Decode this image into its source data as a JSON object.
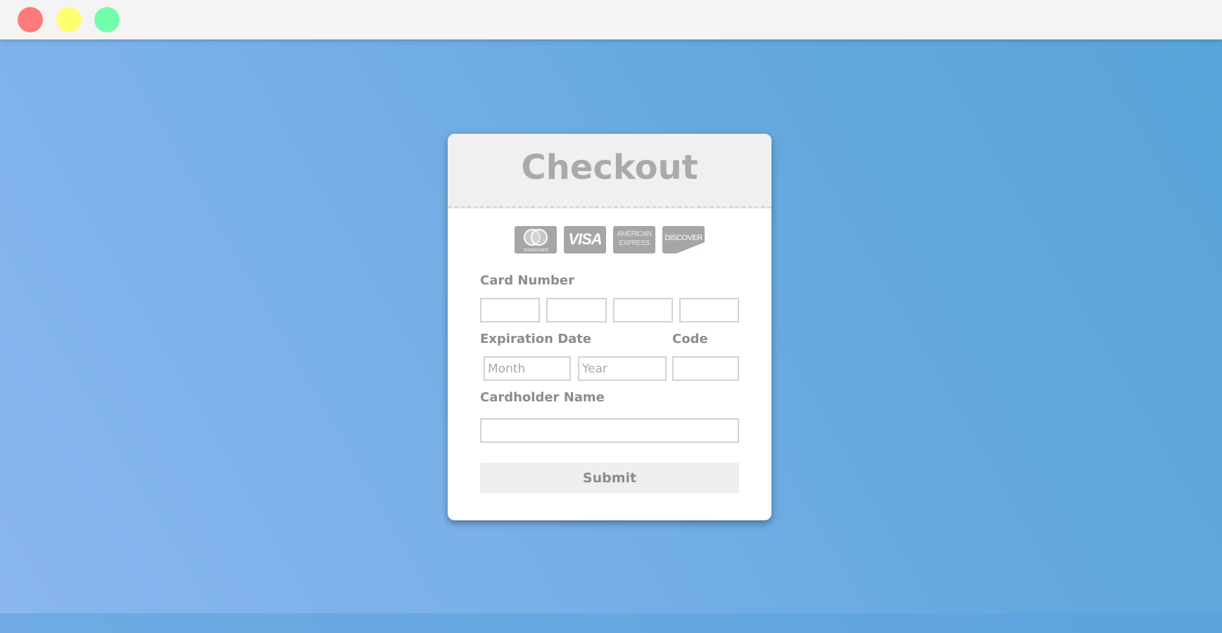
{
  "window": {
    "controls": [
      "close",
      "minimize",
      "maximize"
    ],
    "colors": {
      "close": "#ff7b7b",
      "minimize": "#ffff72",
      "maximize": "#72ffac"
    }
  },
  "checkout": {
    "title": "Checkout",
    "card_logos": [
      {
        "name": "mastercard",
        "text": "mastercard"
      },
      {
        "name": "visa",
        "text": "VISA"
      },
      {
        "name": "american-express",
        "line1": "AMERICAN",
        "line2": "EXPRESS"
      },
      {
        "name": "discover",
        "text": "DISCOVER"
      }
    ],
    "card_number": {
      "label": "Card Number",
      "parts": [
        "",
        "",
        "",
        ""
      ]
    },
    "expiration": {
      "label": "Expiration Date",
      "month_placeholder": "Month",
      "year_placeholder": "Year"
    },
    "code": {
      "label": "Code",
      "value": ""
    },
    "cardholder": {
      "label": "Cardholder Name",
      "value": ""
    },
    "submit_label": "Submit"
  },
  "colors": {
    "background_gradient_start": "#8ab6ef",
    "background_gradient_end": "#58a4da",
    "header_title": "#aaaaaa",
    "label_text": "#8c8c8c",
    "logo_fill": "#a6a6a6"
  }
}
